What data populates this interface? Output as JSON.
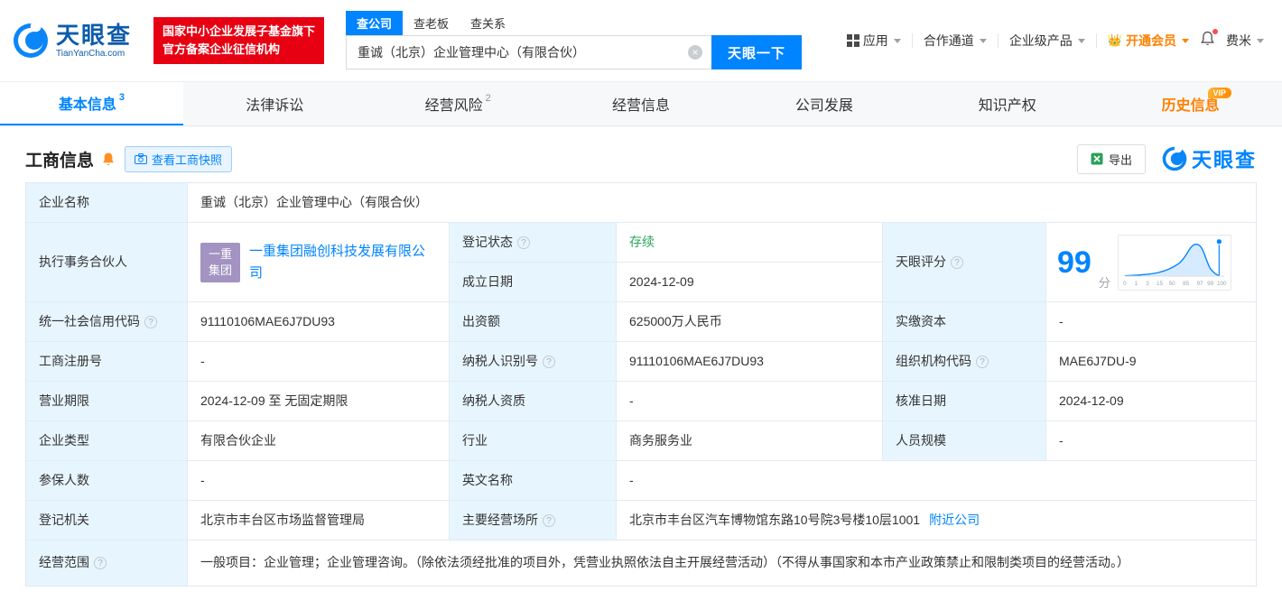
{
  "header": {
    "logo_title": "天眼查",
    "logo_sub": "TianYanCha.com",
    "badge_line1": "国家中小企业发展子基金旗下",
    "badge_line2": "官方备案企业征信机构",
    "search_tabs": [
      {
        "label": "查公司"
      },
      {
        "label": "查老板"
      },
      {
        "label": "查关系"
      }
    ],
    "search_value": "重诚（北京）企业管理中心（有限合伙）",
    "search_button": "天眼一下",
    "nav_apps": "应用",
    "nav_coop": "合作通道",
    "nav_enterprise": "企业级产品",
    "nav_vip": "开通会员",
    "nav_user": "费米"
  },
  "tabs": {
    "basic": "基本信息",
    "basic_badge": "3",
    "legal": "法律诉讼",
    "risk": "经营风险",
    "risk_badge": "2",
    "operation": "经营信息",
    "development": "公司发展",
    "ip": "知识产权",
    "history": "历史信息",
    "history_vip": "VIP"
  },
  "section": {
    "title": "工商信息",
    "snapshot_button": "查看工商快照",
    "export_button": "导出",
    "brand": "天眼查"
  },
  "table": {
    "labels": {
      "company_name": "企业名称",
      "partner": "执行事务合伙人",
      "reg_status": "登记状态",
      "establish_date": "成立日期",
      "score": "天眼评分",
      "credit_code": "统一社会信用代码",
      "capital": "出资额",
      "paid_capital": "实缴资本",
      "reg_number": "工商注册号",
      "taxpayer_id": "纳税人识别号",
      "org_code": "组织机构代码",
      "business_term": "营业期限",
      "taxpayer_quality": "纳税人资质",
      "approval_date": "核准日期",
      "company_type": "企业类型",
      "industry": "行业",
      "staff_size": "人员规模",
      "insured_count": "参保人数",
      "english_name": "英文名称",
      "reg_authority": "登记机关",
      "business_place": "主要经营场所",
      "business_scope": "经营范围"
    },
    "values": {
      "company_name": "重诚（北京）企业管理中心（有限合伙）",
      "partner_logo_line1": "一重",
      "partner_logo_line2": "集团",
      "partner": "一重集团融创科技发展有限公司",
      "reg_status": "存续",
      "establish_date": "2024-12-09",
      "score": "99",
      "score_unit": "分",
      "credit_code": "91110106MAE6J7DU93",
      "capital": "625000万人民币",
      "paid_capital": "-",
      "reg_number": "-",
      "taxpayer_id": "91110106MAE6J7DU93",
      "org_code": "MAE6J7DU-9",
      "business_term": "2024-12-09 至 无固定期限",
      "taxpayer_quality": "-",
      "approval_date": "2024-12-09",
      "company_type": "有限合伙企业",
      "industry": "商务服务业",
      "staff_size": "-",
      "insured_count": "-",
      "english_name": "-",
      "reg_authority": "北京市丰台区市场监督管理局",
      "business_place": "北京市丰台区汽车博物馆东路10号院3号楼10层1001",
      "business_place_link": "附近公司",
      "business_scope": "一般项目：企业管理；企业管理咨询。（除依法须经批准的项目外，凭营业执照依法自主开展经营活动）（不得从事国家和本市产业政策禁止和限制类项目的经营活动。）"
    }
  },
  "score_chart": {
    "type": "area",
    "x_labels": [
      "0",
      "1",
      "3",
      "15",
      "50",
      "85",
      "97",
      "99",
      "100"
    ],
    "marker_value": 99,
    "accent_color": "#0084ff"
  }
}
